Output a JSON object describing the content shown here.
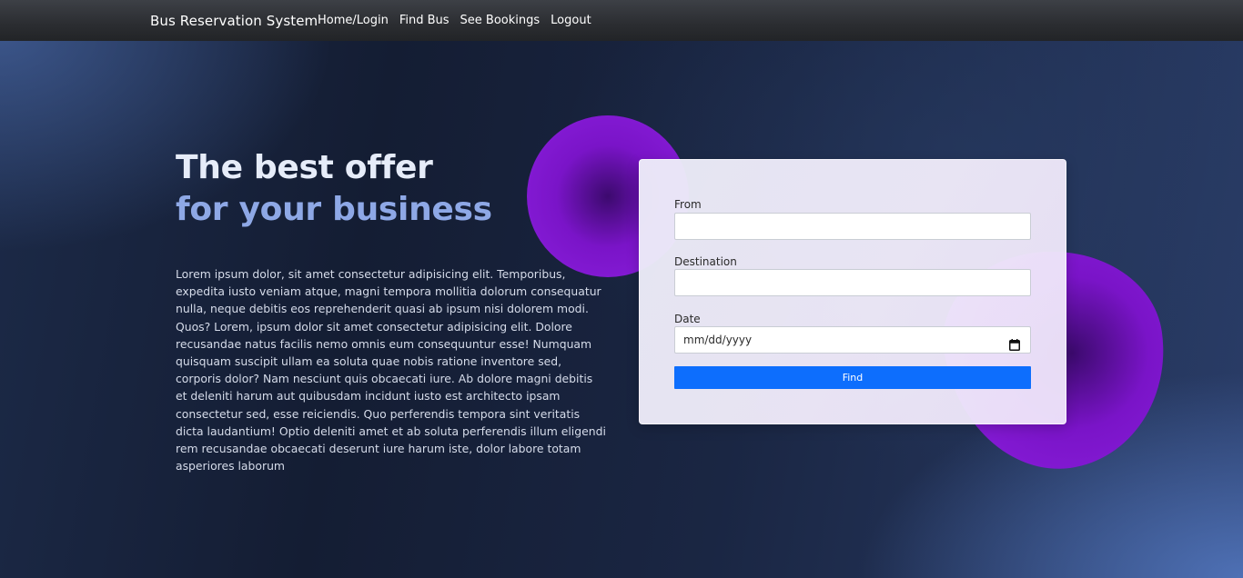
{
  "navbar": {
    "brand": "Bus Reservation System",
    "links": [
      {
        "label": "Home/Login"
      },
      {
        "label": "Find Bus"
      },
      {
        "label": "See Bookings"
      },
      {
        "label": "Logout"
      }
    ]
  },
  "hero": {
    "title_line1": "The best offer",
    "title_line2": "for your business",
    "body": "Lorem ipsum dolor, sit amet consectetur adipisicing elit. Temporibus, expedita iusto veniam atque, magni tempora mollitia dolorum consequatur nulla, neque debitis eos reprehenderit quasi ab ipsum nisi dolorem modi. Quos? Lorem, ipsum dolor sit amet consectetur adipisicing elit. Dolore recusandae natus facilis nemo omnis eum consequuntur esse! Numquam quisquam suscipit ullam ea soluta quae nobis ratione inventore sed, corporis dolor? Nam nesciunt quis obcaecati iure. Ab dolore magni debitis et deleniti harum aut quibusdam incidunt iusto est architecto ipsam consectetur sed, esse reiciendis. Quo perferendis tempora sint veritatis dicta laudantium! Optio deleniti amet et ab soluta perferendis illum eligendi rem recusandae obcaecati deserunt iure harum iste, dolor labore totam asperiores laborum"
  },
  "form": {
    "from_label": "From",
    "from_value": "",
    "destination_label": "Destination",
    "destination_value": "",
    "date_label": "Date",
    "date_placeholder": "mm/dd/yyyy",
    "find_label": "Find",
    "icons": {
      "date": "calendar-icon"
    }
  },
  "colors": {
    "button": "#0d6efd",
    "title_primary": "#e6ecf9",
    "title_accent": "#8ea8e6",
    "blob": "#8b1fdd"
  }
}
